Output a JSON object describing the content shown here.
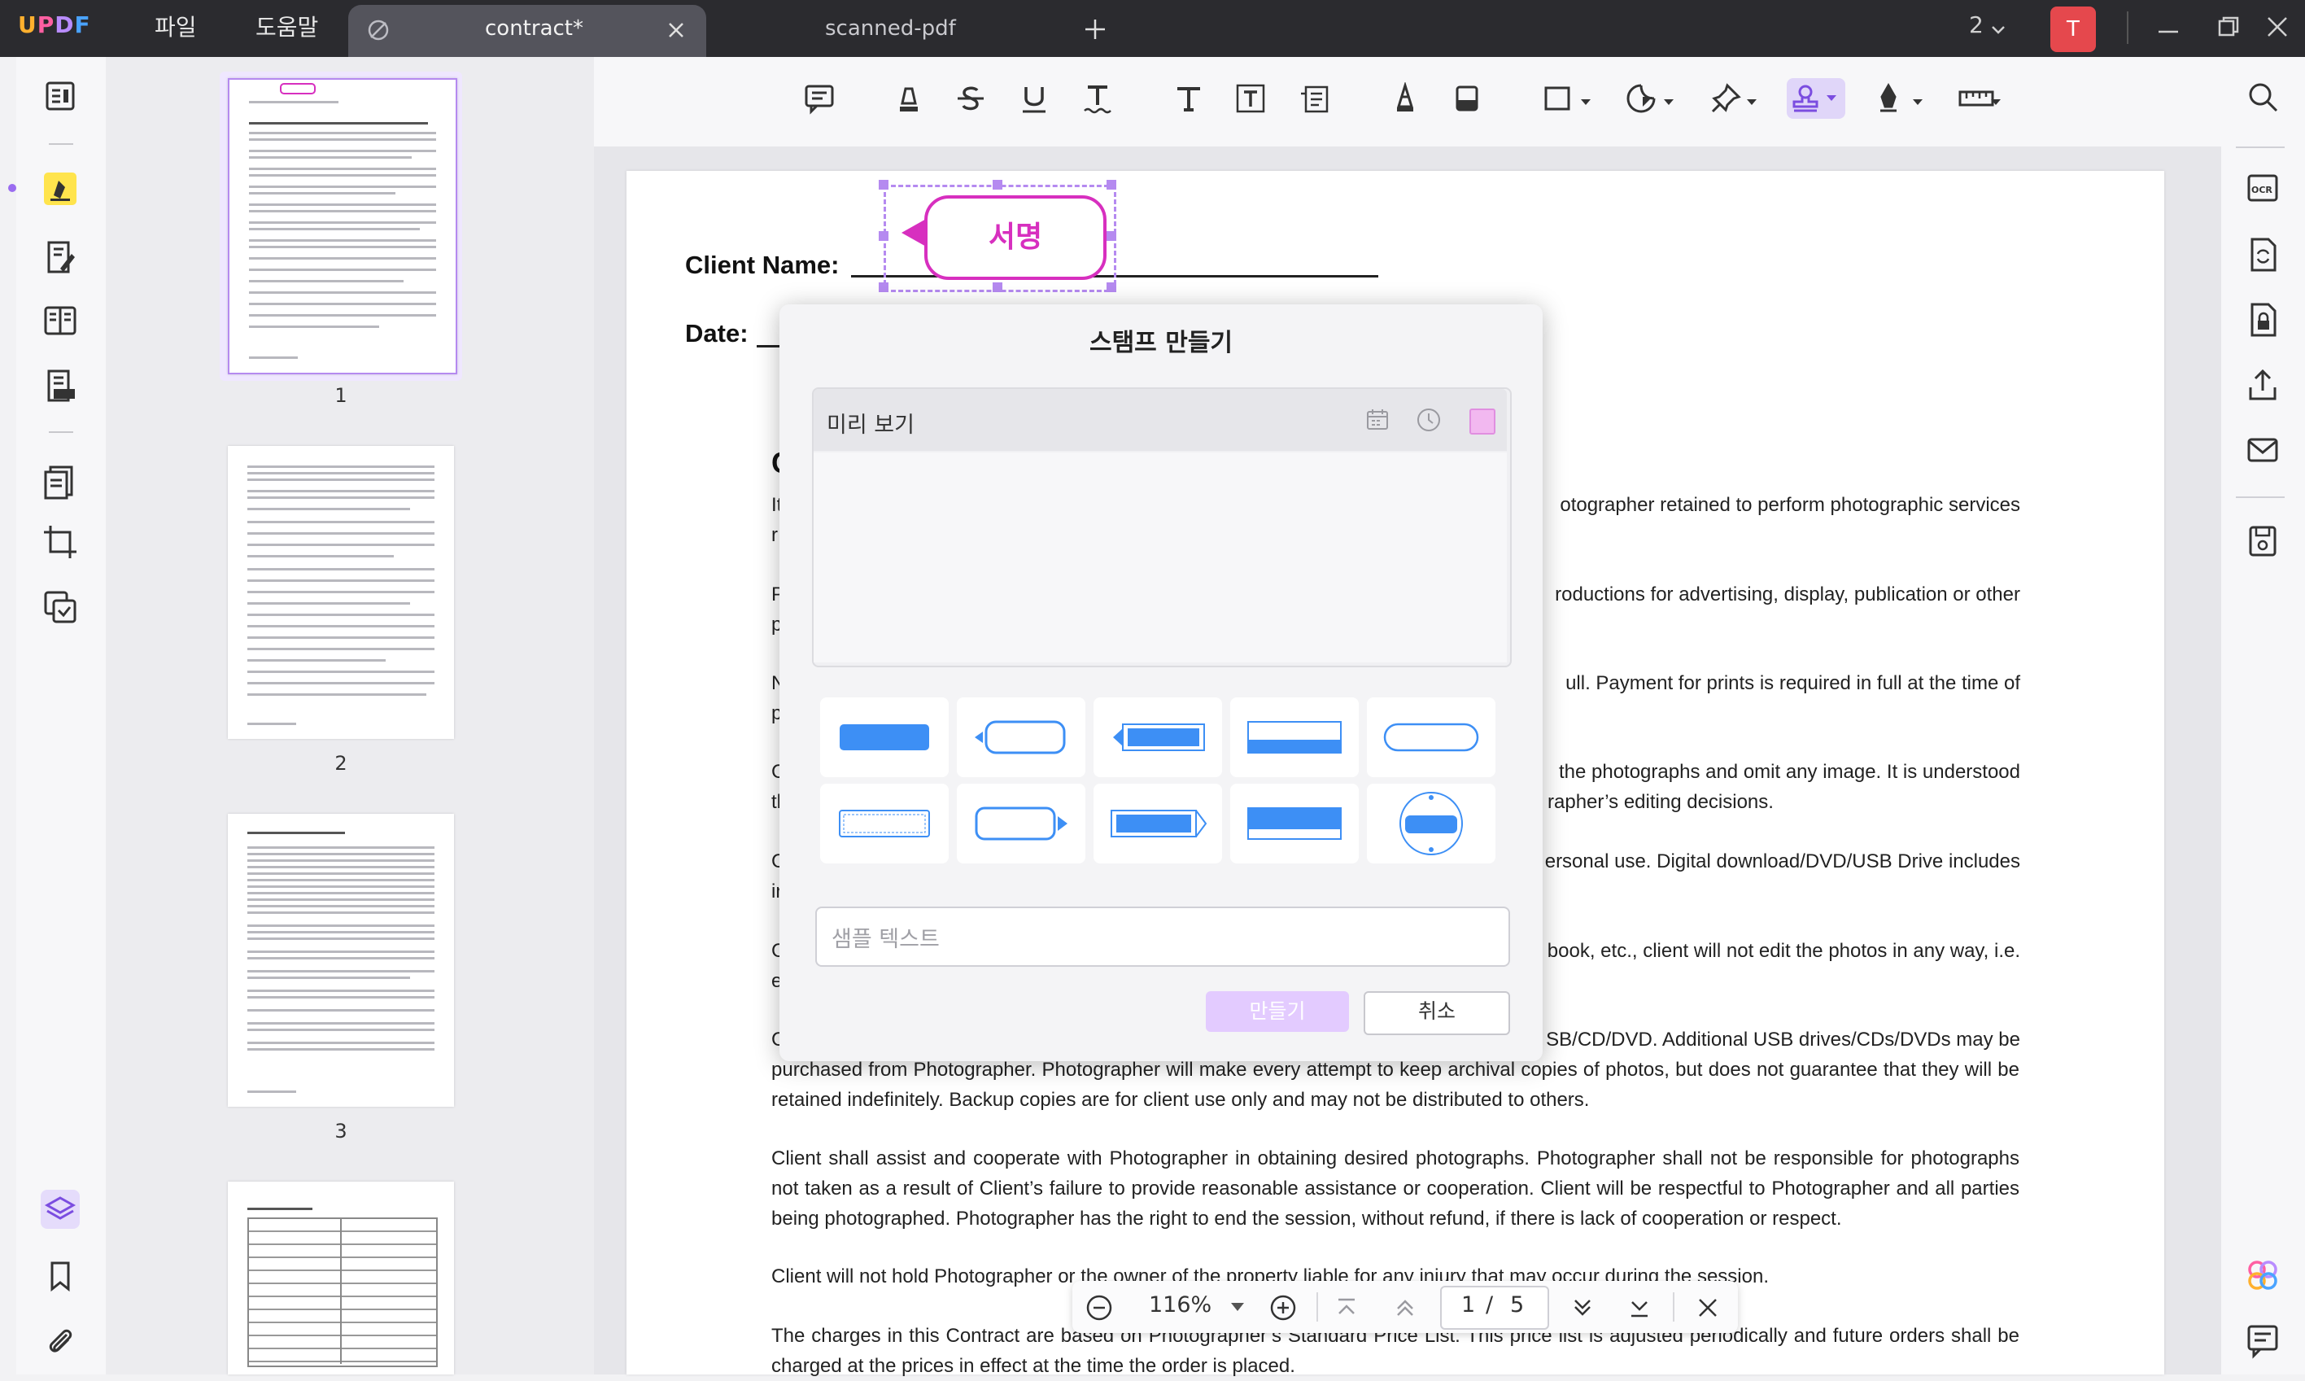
{
  "app": {
    "name": "UPDF"
  },
  "menu": {
    "file": "파일",
    "help": "도움말"
  },
  "tabs": [
    {
      "label": "contract*"
    },
    {
      "label": "scanned-pdf"
    }
  ],
  "window": {
    "page_count_badge": "2",
    "user_initial": "T"
  },
  "thumbnails": {
    "pages": [
      "1",
      "2",
      "3"
    ]
  },
  "document": {
    "client_name_label": "Client Name: ",
    "date_label": "Date: ",
    "heading_initial": "C",
    "lines": [
      {
        "left": "It",
        "right": "otographer retained to perform photographic services"
      },
      {
        "left": "r",
        "right": ""
      },
      {
        "left": "P",
        "right": "roductions for advertising, display, publication or other"
      },
      {
        "left": "p",
        "right": ""
      },
      {
        "left": "N",
        "right": "ull. Payment for prints is required in full at the time of"
      },
      {
        "left": "p",
        "right": ""
      },
      {
        "left": "C",
        "right": "the photographs and omit any image. It is understood"
      },
      {
        "left": "th",
        "right": "rapher’s editing decisions."
      },
      {
        "left": "C",
        "right": "ersonal use. Digital download/DVD/USB Drive includes"
      },
      {
        "left": "in",
        "right": ""
      },
      {
        "left": "C",
        "right": "book, etc., client will not edit the photos in any way, i.e."
      },
      {
        "left": "e",
        "right": ""
      },
      {
        "left": "C",
        "right": "SB/CD/DVD. Additional USB drives/CDs/DVDs may be"
      }
    ],
    "full_lines": [
      "purchased from Photographer. Photographer will make every attempt to keep archival copies of photos, but does not guarantee that they will be",
      "retained indefinitely. Backup copies are for client use only and may not be distributed to others.",
      "Client shall assist and cooperate with Photographer in obtaining desired photographs. Photographer shall not be responsible for photographs",
      "not taken as a result of Client’s failure to provide reasonable assistance or cooperation. Client will be respectful to Photographer and all parties",
      "being photographed. Photographer has the right to end the session, without refund, if there is lack of cooperation or respect.",
      "Client will not hold Photographer or the owner of the property liable for any injury that may occur during the session.",
      "The charges in this Contract are based on Photographer’s Standard Price List. This price list is adjusted periodically and future orders shall be",
      "charged at the prices in effect at the time the order is placed."
    ]
  },
  "stamp": {
    "text": "서명",
    "color": "#d72fbf"
  },
  "dialog": {
    "title": "스탬프 만들기",
    "preview_label": "미리 보기",
    "color_swatch": "#f2b8f0",
    "sample_placeholder": "샘플 텍스트",
    "make_button": "만들기",
    "cancel_button": "취소"
  },
  "zoom": {
    "level": "116%",
    "current_page": "1",
    "separator": "/",
    "total_pages": "5"
  },
  "colors": {
    "accent": "#b58af0",
    "template_blue": "#3d8ff5"
  }
}
